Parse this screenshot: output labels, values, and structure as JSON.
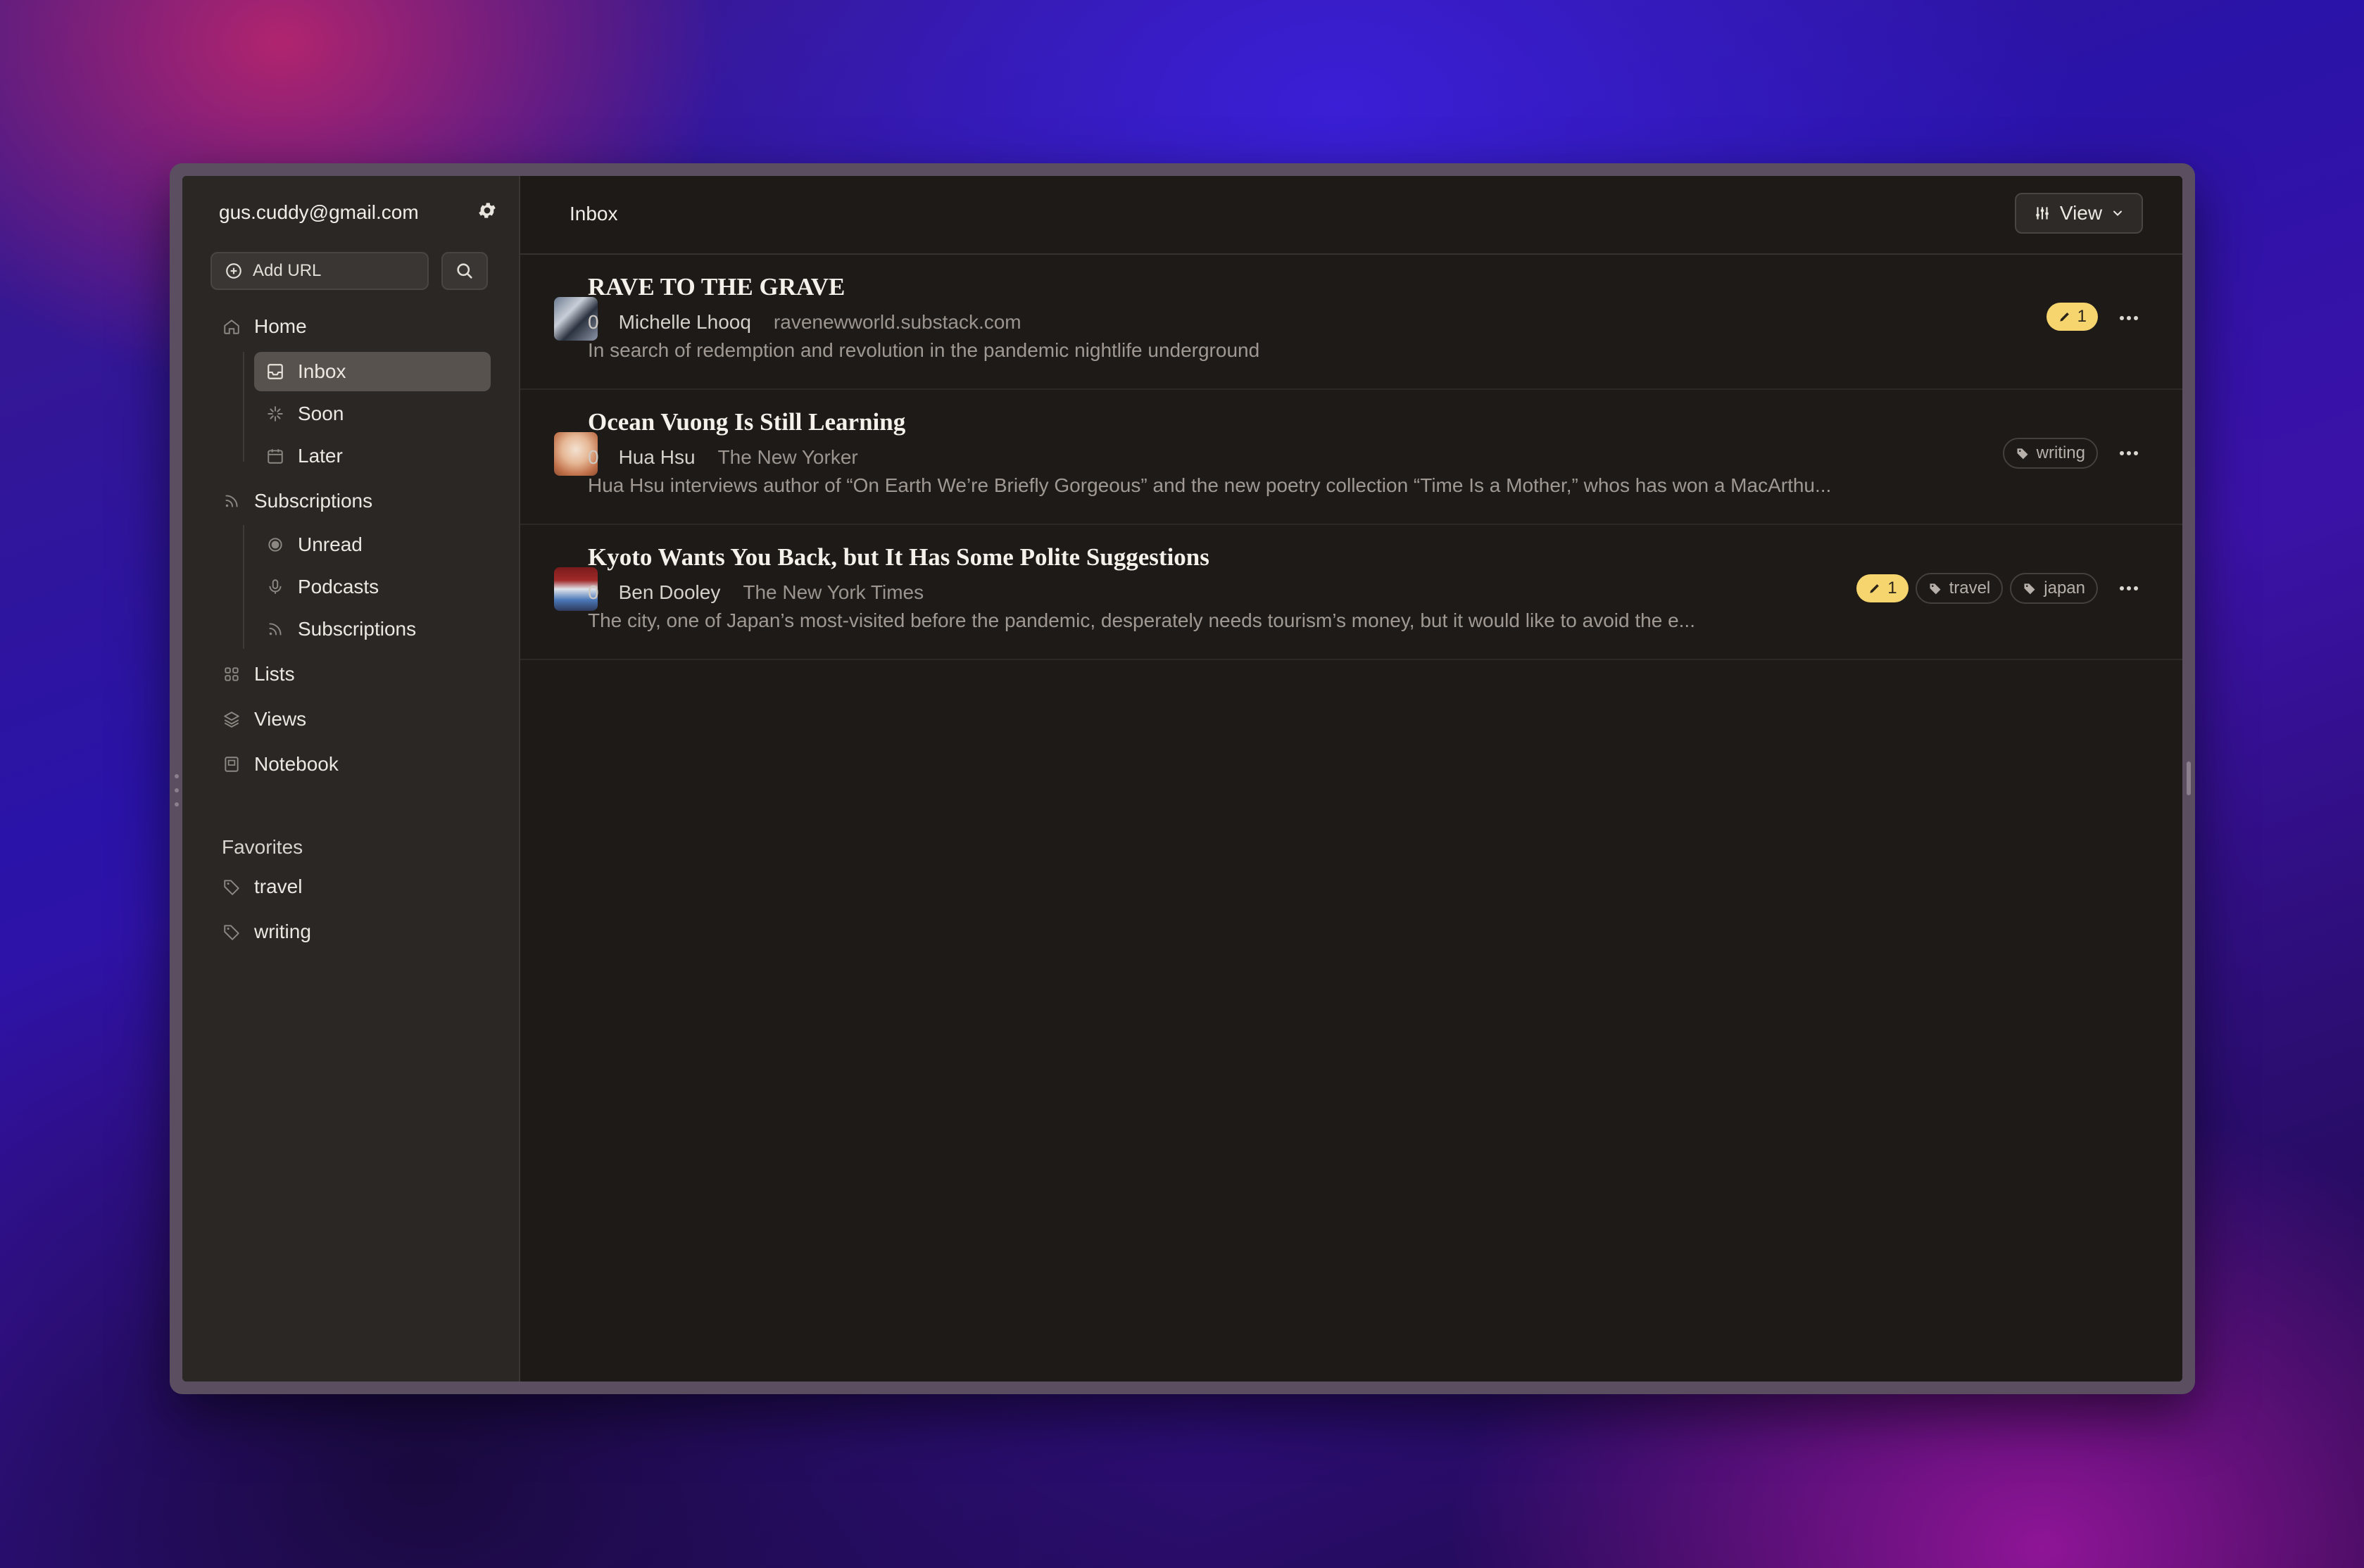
{
  "sidebar": {
    "account_email": "gus.cuddy@gmail.com",
    "add_url_label": "Add URL",
    "nav": {
      "home": "Home",
      "inbox": "Inbox",
      "soon": "Soon",
      "later": "Later",
      "subscriptions": "Subscriptions",
      "unread": "Unread",
      "podcasts": "Podcasts",
      "subscriptions_sub": "Subscriptions",
      "lists": "Lists",
      "views": "Views",
      "notebook": "Notebook"
    },
    "favorites_heading": "Favorites",
    "favorites": [
      "travel",
      "writing"
    ],
    "icons": [
      "gear-icon",
      "plus-circle-icon",
      "search-icon",
      "home-icon",
      "inbox-icon",
      "sparkle-icon",
      "calendar-icon",
      "rss-icon",
      "unread-dot-icon",
      "microphone-icon",
      "grid-icon",
      "layers-icon",
      "notebook-icon",
      "tag-icon"
    ]
  },
  "header": {
    "title": "Inbox",
    "view_label": "View"
  },
  "articles": [
    {
      "title": "RAVE TO THE GRAVE",
      "count": "0",
      "author": "Michelle Lhooq",
      "source": "ravenewworld.substack.com",
      "description": "In search of redemption and revolution in the pandemic nightlife underground",
      "highlights": "1",
      "tags": []
    },
    {
      "title": "Ocean Vuong Is Still Learning",
      "count": "0",
      "author": "Hua Hsu",
      "source": "The New Yorker",
      "description": "Hua Hsu interviews author of “On Earth We’re Briefly Gorgeous” and the new poetry collection “Time Is a Mother,” whos has won a MacArthu...",
      "highlights": "",
      "tags": [
        "writing"
      ]
    },
    {
      "title": "Kyoto Wants You Back, but It Has Some Polite Suggestions",
      "count": "0",
      "author": "Ben Dooley",
      "source": "The New York Times",
      "description": "The city, one of Japan’s most-visited before the pandemic, desperately needs tourism’s money, but it would like to avoid the e...",
      "highlights": "1",
      "tags": [
        "travel",
        "japan"
      ]
    }
  ],
  "colors": {
    "accent_highlight": "#f6d56e",
    "active_nav": "#57524d",
    "background": "#1d1a18"
  }
}
